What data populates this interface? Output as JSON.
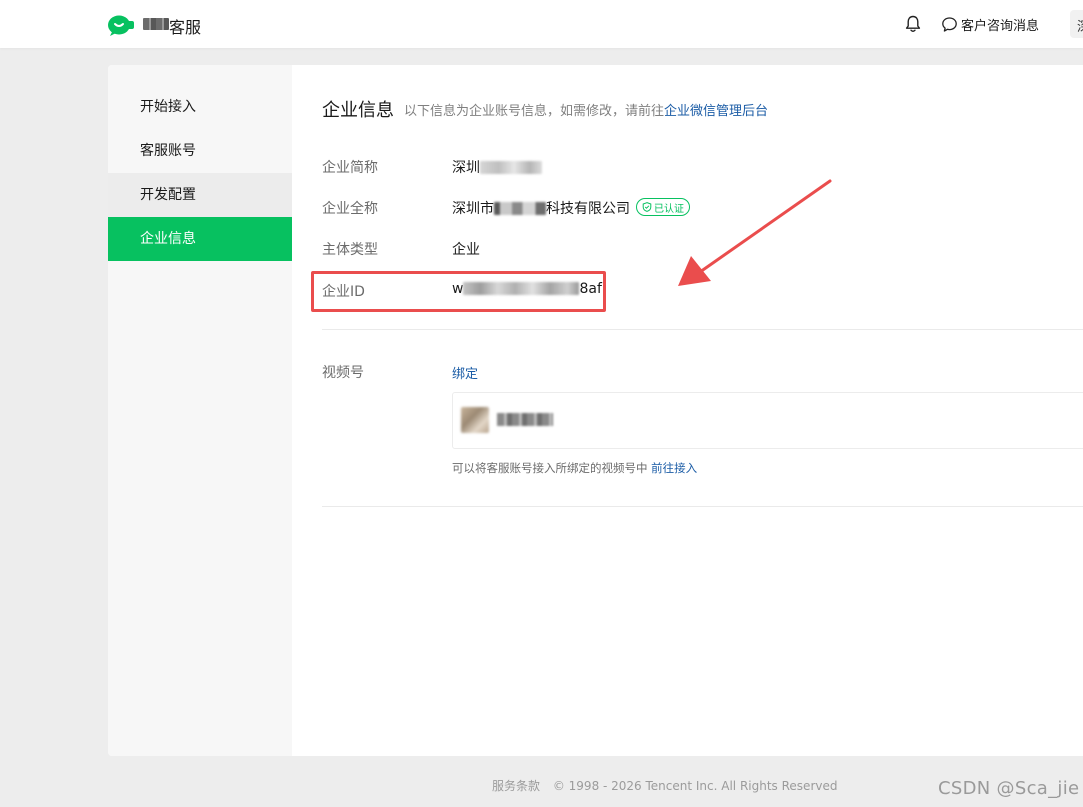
{
  "header": {
    "brand_suffix": "客服",
    "consult_label": "客户咨询消息",
    "avatar_initial": "深"
  },
  "sidebar": {
    "items": [
      {
        "label": "开始接入",
        "state": "normal"
      },
      {
        "label": "客服账号",
        "state": "normal"
      },
      {
        "label": "开发配置",
        "state": "hover"
      },
      {
        "label": "企业信息",
        "state": "active"
      }
    ]
  },
  "page": {
    "title": "企业信息",
    "desc_prefix": "以下信息为企业账号信息，如需修改，请前往",
    "desc_link": "企业微信管理后台"
  },
  "info": {
    "short_name_label": "企业简称",
    "short_name_value": "深圳",
    "full_name_label": "企业全称",
    "full_name_prefix": "深圳市",
    "full_name_suffix": "科技有限公司",
    "verified_badge": "已认证",
    "type_label": "主体类型",
    "type_value": "企业",
    "id_label": "企业ID",
    "id_prefix": "w",
    "id_suffix": "8af"
  },
  "channels": {
    "label": "视频号",
    "bind_link": "绑定",
    "hint_prefix": "可以将客服账号接入所绑定的视频号中",
    "hint_link": "前往接入"
  },
  "footer": {
    "terms": "服务条款",
    "copyright": "© 1998 - 2026 Tencent Inc. All Rights Reserved"
  },
  "watermark": "CSDN @Sca_jie",
  "colors": {
    "brand_green": "#07c160",
    "link_blue": "#1b5ca6",
    "annotation_red": "#ea4d4d"
  }
}
